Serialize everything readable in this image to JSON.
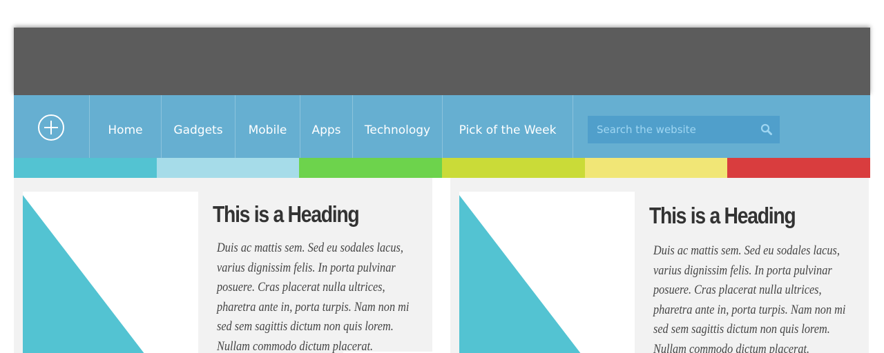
{
  "nav": {
    "logo_icon": "plus-circle-icon",
    "items": [
      {
        "label": "Home"
      },
      {
        "label": "Gadgets"
      },
      {
        "label": "Mobile"
      },
      {
        "label": "Apps"
      },
      {
        "label": "Technology"
      },
      {
        "label": "Pick of the Week"
      }
    ],
    "search": {
      "placeholder": "Search the website",
      "icon": "search-icon"
    }
  },
  "colors": {
    "hero": "#5c5c5c",
    "nav": "#66afd1",
    "stripe": [
      "#53c3d2",
      "#a6dce9",
      "#6dd34c",
      "#cadb38",
      "#f1e676",
      "#d93d3e"
    ]
  },
  "cards": [
    {
      "heading": "This is a Heading",
      "body": "Duis ac mattis sem. Sed eu sodales lacus, varius dignissim felis. In porta pulvinar posuere. Cras placerat nulla ultrices, pharetra ante in, porta turpis. Nam non mi sed sem sagittis dictum non quis lorem. Nullam commodo dictum placerat."
    },
    {
      "heading": "This is a Heading",
      "body": "Duis ac mattis sem. Sed eu sodales lacus, varius dignissim felis. In porta pulvinar posuere. Cras placerat nulla ultrices, pharetra ante in, porta turpis. Nam non mi sed sem sagittis dictum non quis lorem. Nullam commodo dictum placerat."
    }
  ]
}
